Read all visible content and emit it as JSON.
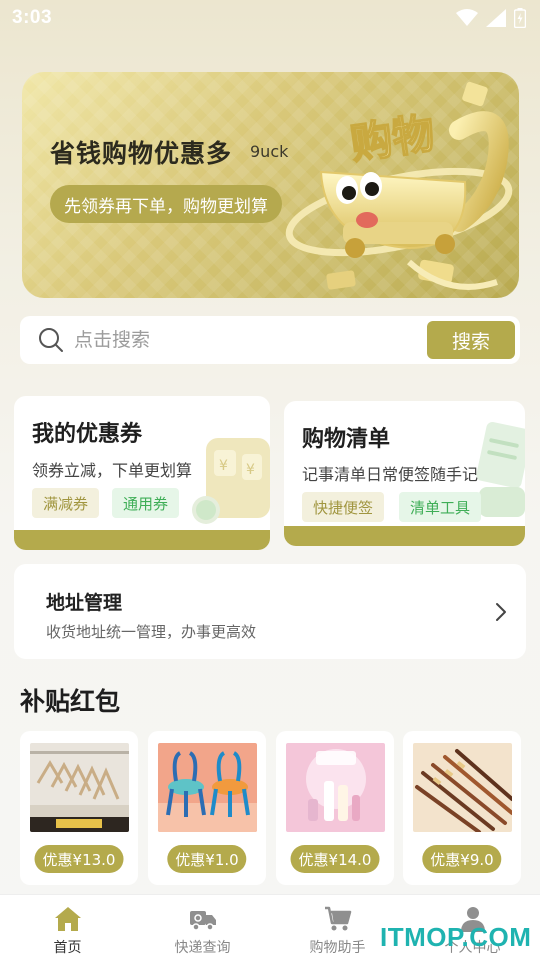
{
  "status_bar": {
    "time": "3:03"
  },
  "banner": {
    "title": "省钱购物优惠多",
    "brand": "9uck",
    "subtitle": "先领券再下单，购物更划算",
    "art_text": "购物"
  },
  "search": {
    "placeholder": "点击搜索",
    "button_label": "搜索"
  },
  "coupon_card": {
    "title": "我的优惠券",
    "desc": "领券立减，下单更划算",
    "tags": [
      "满减券",
      "通用券"
    ]
  },
  "shopping_list_card": {
    "title": "购物清单",
    "desc": "记事清单日常便签随手记",
    "tags": [
      "快捷便签",
      "清单工具"
    ]
  },
  "address_card": {
    "title": "地址管理",
    "desc": "收货地址统一管理，办事更高效"
  },
  "subsidy": {
    "title": "补贴红包",
    "products": [
      {
        "price_label": "优惠¥13.0"
      },
      {
        "price_label": "优惠¥1.0"
      },
      {
        "price_label": "优惠¥14.0"
      },
      {
        "price_label": "优惠¥9.0"
      }
    ]
  },
  "tab_bar": {
    "tabs": [
      {
        "label": "首页",
        "icon": "home-icon",
        "active": true
      },
      {
        "label": "快递查询",
        "icon": "delivery-truck-icon",
        "active": false
      },
      {
        "label": "购物助手",
        "icon": "shopping-cart-icon",
        "active": false
      },
      {
        "label": "个人中心",
        "icon": "person-icon",
        "active": false
      }
    ]
  },
  "watermark": "ITMOP.COM",
  "colors": {
    "accent": "#b4aa4c",
    "tag_olive_text": "#a19640",
    "tag_green_text": "#3fae57",
    "watermark": "#1fb3b0"
  }
}
